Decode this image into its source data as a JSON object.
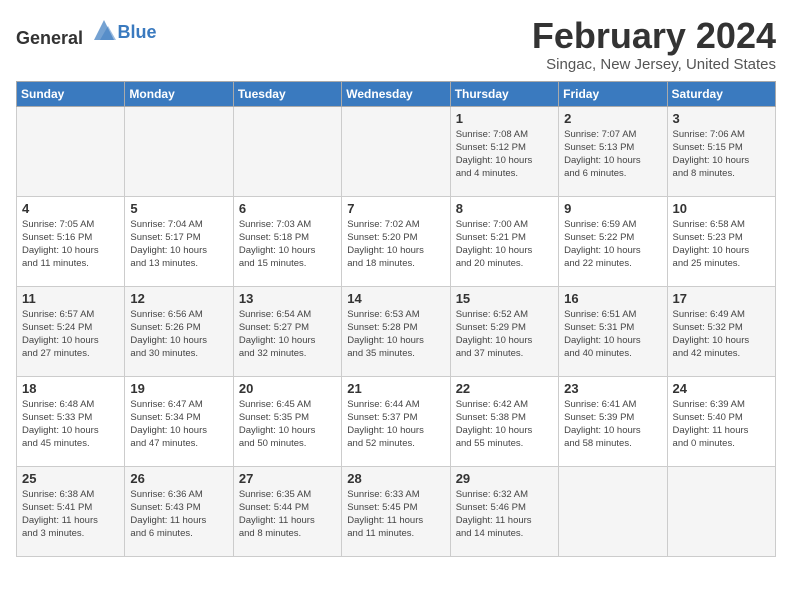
{
  "header": {
    "logo_general": "General",
    "logo_blue": "Blue",
    "month": "February 2024",
    "location": "Singac, New Jersey, United States"
  },
  "weekdays": [
    "Sunday",
    "Monday",
    "Tuesday",
    "Wednesday",
    "Thursday",
    "Friday",
    "Saturday"
  ],
  "weeks": [
    [
      {
        "day": "",
        "info": ""
      },
      {
        "day": "",
        "info": ""
      },
      {
        "day": "",
        "info": ""
      },
      {
        "day": "",
        "info": ""
      },
      {
        "day": "1",
        "info": "Sunrise: 7:08 AM\nSunset: 5:12 PM\nDaylight: 10 hours\nand 4 minutes."
      },
      {
        "day": "2",
        "info": "Sunrise: 7:07 AM\nSunset: 5:13 PM\nDaylight: 10 hours\nand 6 minutes."
      },
      {
        "day": "3",
        "info": "Sunrise: 7:06 AM\nSunset: 5:15 PM\nDaylight: 10 hours\nand 8 minutes."
      }
    ],
    [
      {
        "day": "4",
        "info": "Sunrise: 7:05 AM\nSunset: 5:16 PM\nDaylight: 10 hours\nand 11 minutes."
      },
      {
        "day": "5",
        "info": "Sunrise: 7:04 AM\nSunset: 5:17 PM\nDaylight: 10 hours\nand 13 minutes."
      },
      {
        "day": "6",
        "info": "Sunrise: 7:03 AM\nSunset: 5:18 PM\nDaylight: 10 hours\nand 15 minutes."
      },
      {
        "day": "7",
        "info": "Sunrise: 7:02 AM\nSunset: 5:20 PM\nDaylight: 10 hours\nand 18 minutes."
      },
      {
        "day": "8",
        "info": "Sunrise: 7:00 AM\nSunset: 5:21 PM\nDaylight: 10 hours\nand 20 minutes."
      },
      {
        "day": "9",
        "info": "Sunrise: 6:59 AM\nSunset: 5:22 PM\nDaylight: 10 hours\nand 22 minutes."
      },
      {
        "day": "10",
        "info": "Sunrise: 6:58 AM\nSunset: 5:23 PM\nDaylight: 10 hours\nand 25 minutes."
      }
    ],
    [
      {
        "day": "11",
        "info": "Sunrise: 6:57 AM\nSunset: 5:24 PM\nDaylight: 10 hours\nand 27 minutes."
      },
      {
        "day": "12",
        "info": "Sunrise: 6:56 AM\nSunset: 5:26 PM\nDaylight: 10 hours\nand 30 minutes."
      },
      {
        "day": "13",
        "info": "Sunrise: 6:54 AM\nSunset: 5:27 PM\nDaylight: 10 hours\nand 32 minutes."
      },
      {
        "day": "14",
        "info": "Sunrise: 6:53 AM\nSunset: 5:28 PM\nDaylight: 10 hours\nand 35 minutes."
      },
      {
        "day": "15",
        "info": "Sunrise: 6:52 AM\nSunset: 5:29 PM\nDaylight: 10 hours\nand 37 minutes."
      },
      {
        "day": "16",
        "info": "Sunrise: 6:51 AM\nSunset: 5:31 PM\nDaylight: 10 hours\nand 40 minutes."
      },
      {
        "day": "17",
        "info": "Sunrise: 6:49 AM\nSunset: 5:32 PM\nDaylight: 10 hours\nand 42 minutes."
      }
    ],
    [
      {
        "day": "18",
        "info": "Sunrise: 6:48 AM\nSunset: 5:33 PM\nDaylight: 10 hours\nand 45 minutes."
      },
      {
        "day": "19",
        "info": "Sunrise: 6:47 AM\nSunset: 5:34 PM\nDaylight: 10 hours\nand 47 minutes."
      },
      {
        "day": "20",
        "info": "Sunrise: 6:45 AM\nSunset: 5:35 PM\nDaylight: 10 hours\nand 50 minutes."
      },
      {
        "day": "21",
        "info": "Sunrise: 6:44 AM\nSunset: 5:37 PM\nDaylight: 10 hours\nand 52 minutes."
      },
      {
        "day": "22",
        "info": "Sunrise: 6:42 AM\nSunset: 5:38 PM\nDaylight: 10 hours\nand 55 minutes."
      },
      {
        "day": "23",
        "info": "Sunrise: 6:41 AM\nSunset: 5:39 PM\nDaylight: 10 hours\nand 58 minutes."
      },
      {
        "day": "24",
        "info": "Sunrise: 6:39 AM\nSunset: 5:40 PM\nDaylight: 11 hours\nand 0 minutes."
      }
    ],
    [
      {
        "day": "25",
        "info": "Sunrise: 6:38 AM\nSunset: 5:41 PM\nDaylight: 11 hours\nand 3 minutes."
      },
      {
        "day": "26",
        "info": "Sunrise: 6:36 AM\nSunset: 5:43 PM\nDaylight: 11 hours\nand 6 minutes."
      },
      {
        "day": "27",
        "info": "Sunrise: 6:35 AM\nSunset: 5:44 PM\nDaylight: 11 hours\nand 8 minutes."
      },
      {
        "day": "28",
        "info": "Sunrise: 6:33 AM\nSunset: 5:45 PM\nDaylight: 11 hours\nand 11 minutes."
      },
      {
        "day": "29",
        "info": "Sunrise: 6:32 AM\nSunset: 5:46 PM\nDaylight: 11 hours\nand 14 minutes."
      },
      {
        "day": "",
        "info": ""
      },
      {
        "day": "",
        "info": ""
      }
    ]
  ]
}
